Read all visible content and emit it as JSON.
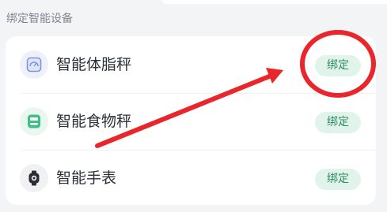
{
  "section": {
    "title": "绑定智能设备"
  },
  "devices": [
    {
      "label": "智能体脂秤",
      "icon": "body-fat-scale-icon",
      "button_label": "绑定"
    },
    {
      "label": "智能食物秤",
      "icon": "food-scale-icon",
      "button_label": "绑定"
    },
    {
      "label": "智能手表",
      "icon": "smartwatch-icon",
      "button_label": "绑定"
    }
  ],
  "colors": {
    "page_background": "#f3f4f6",
    "card_background": "#ffffff",
    "button_background": "#e1f4eb",
    "button_text": "#2e8c63",
    "annotation_red": "#e8262c"
  }
}
